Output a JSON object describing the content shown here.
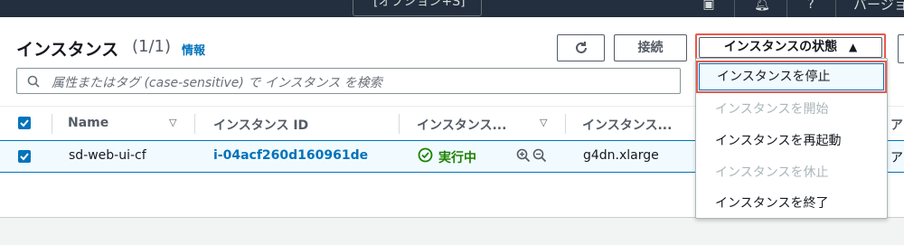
{
  "topnav": {
    "search_tail": "[オプション+S]",
    "user_menu": "バージョン"
  },
  "header": {
    "title": "インスタンス",
    "count": "(1/1)",
    "info_link": "情報",
    "connect_label": "接続",
    "state_label": "インスタンスの状態",
    "state_caret": "▲"
  },
  "search": {
    "placeholder": "属性またはタグ (case-sensitive) で インスタンス を検索"
  },
  "table": {
    "columns": [
      "Name",
      "インスタンス ID",
      "インスタンス...",
      "インスタンス...",
      "ア"
    ],
    "rows": [
      {
        "name": "sd-web-ui-cf",
        "instance_id": "i-04acf260d160961de",
        "state": "実行中",
        "type": "g4dn.xlarge",
        "extra": "ア"
      }
    ]
  },
  "dropdown": {
    "items": [
      {
        "label": "インスタンスを停止",
        "disabled": false,
        "highlighted": true
      },
      {
        "label": "インスタンスを開始",
        "disabled": true
      },
      {
        "label": "インスタンスを再起動",
        "disabled": false
      },
      {
        "label": "インスタンスを休止",
        "disabled": true
      },
      {
        "label": "インスタンスを終了",
        "disabled": false
      }
    ]
  },
  "colors": {
    "accent": "#0073bb",
    "running": "#1d8102",
    "highlight_outline": "#e85a4f",
    "nav_bg": "#232f3e"
  }
}
